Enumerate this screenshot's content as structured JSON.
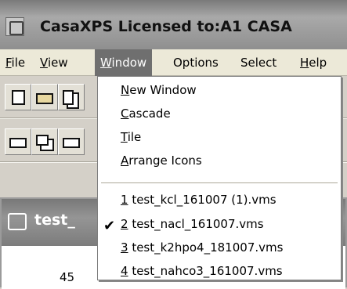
{
  "window": {
    "title": "CasaXPS Licensed to:A1 CASA"
  },
  "menubar": [
    {
      "id": "file",
      "first": "F",
      "rest": "ile"
    },
    {
      "id": "view",
      "first": "V",
      "rest": "iew"
    },
    {
      "id": "window",
      "first": "W",
      "rest": "indow"
    },
    {
      "id": "options",
      "first": "",
      "rest": "Options"
    },
    {
      "id": "select",
      "first": "",
      "rest": "Select"
    },
    {
      "id": "help",
      "first": "H",
      "rest": "elp"
    }
  ],
  "window_menu": {
    "items": [
      {
        "first": "N",
        "rest": "ew Window"
      },
      {
        "first": "C",
        "rest": "ascade"
      },
      {
        "first": "T",
        "rest": "ile"
      },
      {
        "first": "A",
        "rest": "rrange Icons"
      }
    ],
    "files": [
      {
        "num": "1",
        "name": " test_kcl_161007 (1).vms"
      },
      {
        "num": "2",
        "name": " test_nacl_161007.vms"
      },
      {
        "num": "3",
        "name": " test_k2hpo4_181007.vms"
      },
      {
        "num": "4",
        "name": " test_nahco3_161007.vms"
      }
    ],
    "checkmark": "✔"
  },
  "child_window": {
    "title": "test_",
    "axis_value": "45"
  }
}
